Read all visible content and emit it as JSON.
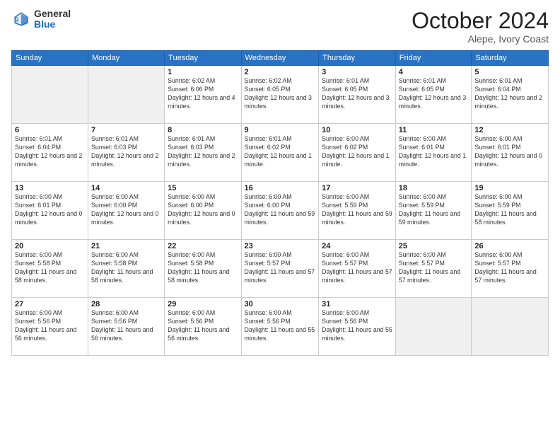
{
  "logo": {
    "general": "General",
    "blue": "Blue"
  },
  "header": {
    "month": "October 2024",
    "location": "Alepe, Ivory Coast"
  },
  "weekdays": [
    "Sunday",
    "Monday",
    "Tuesday",
    "Wednesday",
    "Thursday",
    "Friday",
    "Saturday"
  ],
  "weeks": [
    [
      {
        "day": "",
        "empty": true
      },
      {
        "day": "",
        "empty": true
      },
      {
        "day": "1",
        "sunrise": "Sunrise: 6:02 AM",
        "sunset": "Sunset: 6:06 PM",
        "daylight": "Daylight: 12 hours and 4 minutes."
      },
      {
        "day": "2",
        "sunrise": "Sunrise: 6:02 AM",
        "sunset": "Sunset: 6:05 PM",
        "daylight": "Daylight: 12 hours and 3 minutes."
      },
      {
        "day": "3",
        "sunrise": "Sunrise: 6:01 AM",
        "sunset": "Sunset: 6:05 PM",
        "daylight": "Daylight: 12 hours and 3 minutes."
      },
      {
        "day": "4",
        "sunrise": "Sunrise: 6:01 AM",
        "sunset": "Sunset: 6:05 PM",
        "daylight": "Daylight: 12 hours and 3 minutes."
      },
      {
        "day": "5",
        "sunrise": "Sunrise: 6:01 AM",
        "sunset": "Sunset: 6:04 PM",
        "daylight": "Daylight: 12 hours and 2 minutes."
      }
    ],
    [
      {
        "day": "6",
        "sunrise": "Sunrise: 6:01 AM",
        "sunset": "Sunset: 6:04 PM",
        "daylight": "Daylight: 12 hours and 2 minutes."
      },
      {
        "day": "7",
        "sunrise": "Sunrise: 6:01 AM",
        "sunset": "Sunset: 6:03 PM",
        "daylight": "Daylight: 12 hours and 2 minutes."
      },
      {
        "day": "8",
        "sunrise": "Sunrise: 6:01 AM",
        "sunset": "Sunset: 6:03 PM",
        "daylight": "Daylight: 12 hours and 2 minutes."
      },
      {
        "day": "9",
        "sunrise": "Sunrise: 6:01 AM",
        "sunset": "Sunset: 6:02 PM",
        "daylight": "Daylight: 12 hours and 1 minute."
      },
      {
        "day": "10",
        "sunrise": "Sunrise: 6:00 AM",
        "sunset": "Sunset: 6:02 PM",
        "daylight": "Daylight: 12 hours and 1 minute."
      },
      {
        "day": "11",
        "sunrise": "Sunrise: 6:00 AM",
        "sunset": "Sunset: 6:01 PM",
        "daylight": "Daylight: 12 hours and 1 minute."
      },
      {
        "day": "12",
        "sunrise": "Sunrise: 6:00 AM",
        "sunset": "Sunset: 6:01 PM",
        "daylight": "Daylight: 12 hours and 0 minutes."
      }
    ],
    [
      {
        "day": "13",
        "sunrise": "Sunrise: 6:00 AM",
        "sunset": "Sunset: 6:01 PM",
        "daylight": "Daylight: 12 hours and 0 minutes."
      },
      {
        "day": "14",
        "sunrise": "Sunrise: 6:00 AM",
        "sunset": "Sunset: 6:00 PM",
        "daylight": "Daylight: 12 hours and 0 minutes."
      },
      {
        "day": "15",
        "sunrise": "Sunrise: 6:00 AM",
        "sunset": "Sunset: 6:00 PM",
        "daylight": "Daylight: 12 hours and 0 minutes."
      },
      {
        "day": "16",
        "sunrise": "Sunrise: 6:00 AM",
        "sunset": "Sunset: 6:00 PM",
        "daylight": "Daylight: 11 hours and 59 minutes."
      },
      {
        "day": "17",
        "sunrise": "Sunrise: 6:00 AM",
        "sunset": "Sunset: 5:59 PM",
        "daylight": "Daylight: 11 hours and 59 minutes."
      },
      {
        "day": "18",
        "sunrise": "Sunrise: 6:00 AM",
        "sunset": "Sunset: 5:59 PM",
        "daylight": "Daylight: 11 hours and 59 minutes."
      },
      {
        "day": "19",
        "sunrise": "Sunrise: 6:00 AM",
        "sunset": "Sunset: 5:59 PM",
        "daylight": "Daylight: 11 hours and 58 minutes."
      }
    ],
    [
      {
        "day": "20",
        "sunrise": "Sunrise: 6:00 AM",
        "sunset": "Sunset: 5:58 PM",
        "daylight": "Daylight: 11 hours and 58 minutes."
      },
      {
        "day": "21",
        "sunrise": "Sunrise: 6:00 AM",
        "sunset": "Sunset: 5:58 PM",
        "daylight": "Daylight: 11 hours and 58 minutes."
      },
      {
        "day": "22",
        "sunrise": "Sunrise: 6:00 AM",
        "sunset": "Sunset: 5:58 PM",
        "daylight": "Daylight: 11 hours and 58 minutes."
      },
      {
        "day": "23",
        "sunrise": "Sunrise: 6:00 AM",
        "sunset": "Sunset: 5:57 PM",
        "daylight": "Daylight: 11 hours and 57 minutes."
      },
      {
        "day": "24",
        "sunrise": "Sunrise: 6:00 AM",
        "sunset": "Sunset: 5:57 PM",
        "daylight": "Daylight: 11 hours and 57 minutes."
      },
      {
        "day": "25",
        "sunrise": "Sunrise: 6:00 AM",
        "sunset": "Sunset: 5:57 PM",
        "daylight": "Daylight: 11 hours and 57 minutes."
      },
      {
        "day": "26",
        "sunrise": "Sunrise: 6:00 AM",
        "sunset": "Sunset: 5:57 PM",
        "daylight": "Daylight: 11 hours and 57 minutes."
      }
    ],
    [
      {
        "day": "27",
        "sunrise": "Sunrise: 6:00 AM",
        "sunset": "Sunset: 5:56 PM",
        "daylight": "Daylight: 11 hours and 56 minutes."
      },
      {
        "day": "28",
        "sunrise": "Sunrise: 6:00 AM",
        "sunset": "Sunset: 5:56 PM",
        "daylight": "Daylight: 11 hours and 56 minutes."
      },
      {
        "day": "29",
        "sunrise": "Sunrise: 6:00 AM",
        "sunset": "Sunset: 5:56 PM",
        "daylight": "Daylight: 11 hours and 56 minutes."
      },
      {
        "day": "30",
        "sunrise": "Sunrise: 6:00 AM",
        "sunset": "Sunset: 5:56 PM",
        "daylight": "Daylight: 11 hours and 55 minutes."
      },
      {
        "day": "31",
        "sunrise": "Sunrise: 6:00 AM",
        "sunset": "Sunset: 5:56 PM",
        "daylight": "Daylight: 11 hours and 55 minutes."
      },
      {
        "day": "",
        "empty": true
      },
      {
        "day": "",
        "empty": true
      }
    ]
  ]
}
